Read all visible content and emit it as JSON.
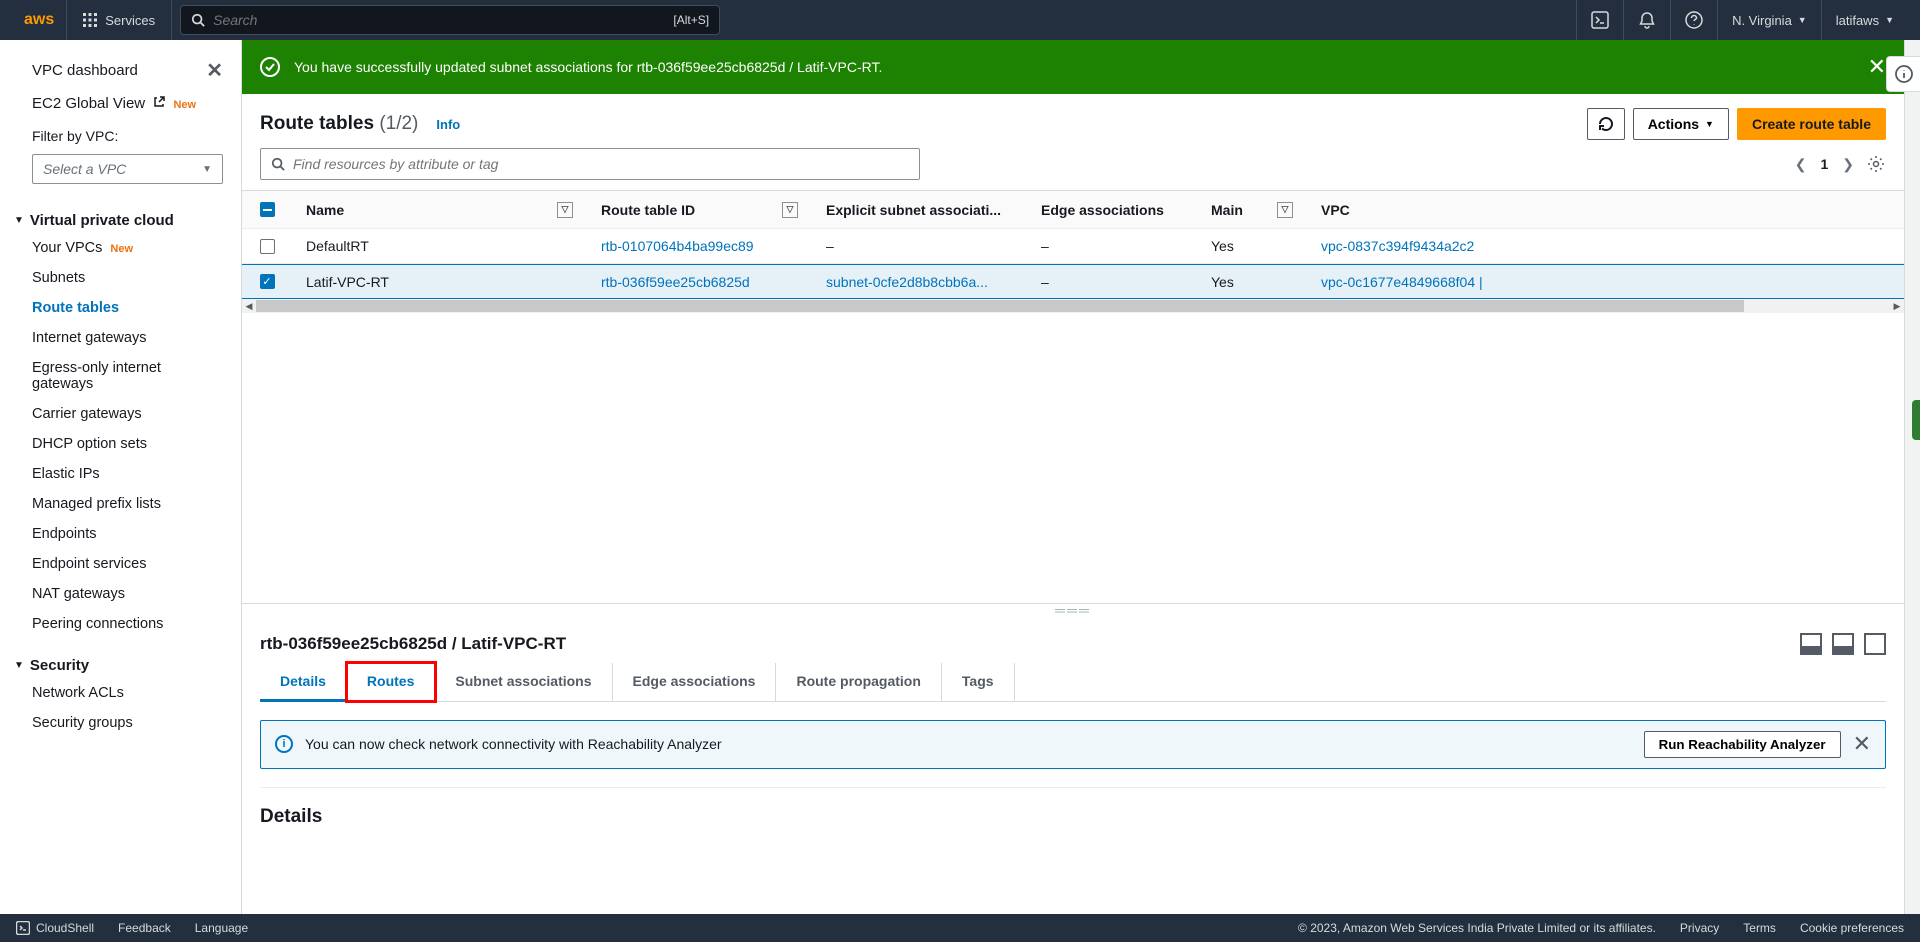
{
  "nav": {
    "logo": "aws",
    "services": "Services",
    "search_placeholder": "Search",
    "search_shortcut": "[Alt+S]",
    "region": "N. Virginia",
    "user": "latifaws"
  },
  "sidebar": {
    "dashboard": "VPC dashboard",
    "ec2": "EC2 Global View",
    "new": "New",
    "filter_label": "Filter by VPC:",
    "vpc_select": "Select a VPC",
    "section_vpc": "Virtual private cloud",
    "items_vpc": [
      "Your VPCs",
      "Subnets",
      "Route tables",
      "Internet gateways",
      "Egress-only internet gateways",
      "Carrier gateways",
      "DHCP option sets",
      "Elastic IPs",
      "Managed prefix lists",
      "Endpoints",
      "Endpoint services",
      "NAT gateways",
      "Peering connections"
    ],
    "section_sec": "Security",
    "items_sec": [
      "Network ACLs",
      "Security groups"
    ]
  },
  "flash": {
    "msg": "You have successfully updated subnet associations for rtb-036f59ee25cb6825d / Latif-VPC-RT."
  },
  "header": {
    "title": "Route tables",
    "count": "(1/2)",
    "info": "Info",
    "actions": "Actions",
    "create": "Create route table",
    "search_placeholder": "Find resources by attribute or tag",
    "page": "1"
  },
  "table": {
    "cols": {
      "name": "Name",
      "rtid": "Route table ID",
      "subnet": "Explicit subnet associati...",
      "edge": "Edge associations",
      "main": "Main",
      "vpc": "VPC"
    },
    "rows": [
      {
        "selected": false,
        "name": "DefaultRT",
        "rtid": "rtb-0107064b4ba99ec89",
        "subnet": "–",
        "edge": "–",
        "main": "Yes",
        "vpc": "vpc-0837c394f9434a2c2"
      },
      {
        "selected": true,
        "name": "Latif-VPC-RT",
        "rtid": "rtb-036f59ee25cb6825d",
        "subnet": "subnet-0cfe2d8b8cbb6a...",
        "edge": "–",
        "main": "Yes",
        "vpc": "vpc-0c1677e4849668f04 |"
      }
    ]
  },
  "detail": {
    "title": "rtb-036f59ee25cb6825d / Latif-VPC-RT",
    "tabs": [
      "Details",
      "Routes",
      "Subnet associations",
      "Edge associations",
      "Route propagation",
      "Tags"
    ],
    "reach_msg": "You can now check network connectivity with Reachability Analyzer",
    "reach_btn": "Run Reachability Analyzer",
    "section": "Details"
  },
  "footer": {
    "cloudshell": "CloudShell",
    "feedback": "Feedback",
    "language": "Language",
    "copyright": "© 2023, Amazon Web Services India Private Limited or its affiliates.",
    "privacy": "Privacy",
    "terms": "Terms",
    "cookies": "Cookie preferences"
  }
}
